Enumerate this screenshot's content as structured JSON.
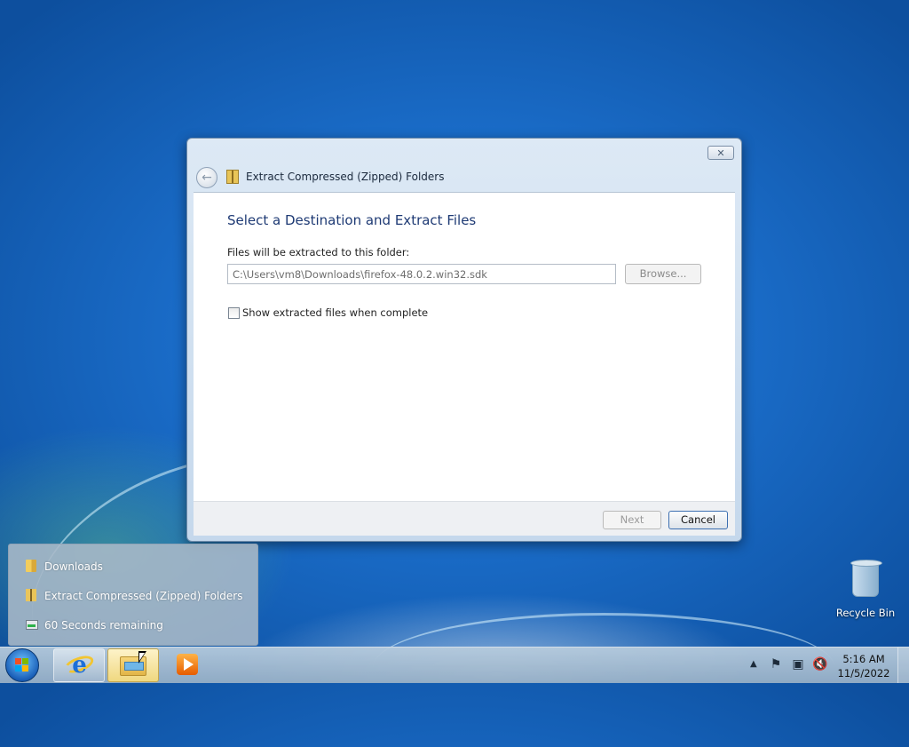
{
  "dialog": {
    "title": "Extract Compressed (Zipped) Folders",
    "close_glyph": "✕",
    "back_glyph": "←",
    "heading": "Select a Destination and Extract Files",
    "destination_label": "Files will be extracted to this folder:",
    "destination_value": "C:\\Users\\vm8\\Downloads\\firefox-48.0.2.win32.sdk",
    "browse_label": "Browse...",
    "show_files_label": "Show extracted files when complete",
    "show_files_checked": false,
    "next_label": "Next",
    "cancel_label": "Cancel"
  },
  "jumplist": {
    "items": [
      {
        "label": "Downloads",
        "icon": "folder-icon"
      },
      {
        "label": "Extract Compressed (Zipped) Folders",
        "icon": "zip-folder-icon"
      },
      {
        "label": "60 Seconds remaining",
        "icon": "progress-icon"
      }
    ]
  },
  "desktop": {
    "recycle_bin_label": "Recycle Bin"
  },
  "taskbar": {
    "tray_arrow": "▲",
    "clock_time": "5:16 AM",
    "clock_date": "11/5/2022"
  }
}
